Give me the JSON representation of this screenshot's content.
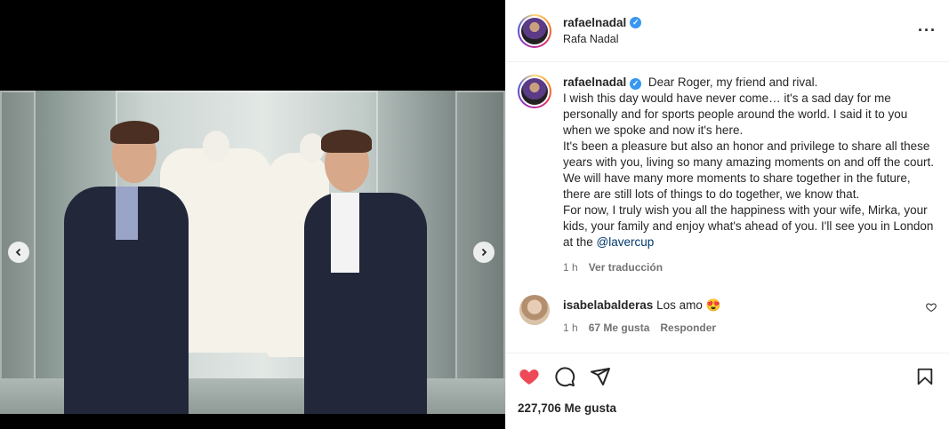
{
  "post": {
    "username": "rafaelnadal",
    "fullname": "Rafa Nadal",
    "verified_icon": "verified-badge-icon",
    "more_icon": "more-options-icon"
  },
  "caption": {
    "username": "rafaelnadal",
    "line1": "Dear Roger, my friend and rival.",
    "line2": "I wish this day would have never come… it's a sad day for me personally and for sports people around the world. I said it to you when we spoke and now it's here.",
    "line3": "It's been a pleasure but also an honor and privilege to share all these years with you, living so many amazing moments on and off the court.",
    "line4": "We will have many more moments to share together in the future, there are still lots of things to do together, we know that.",
    "line5_start": "For now, I truly wish you all the happiness with your wife, Mirka, your kids, your family and enjoy what's ahead of you. I'll see you in London at the ",
    "mention": "@lavercup",
    "time": "1 h",
    "see_translation": "Ver traducción"
  },
  "comment": {
    "username": "isabelabalderas",
    "text": "Los amo 😍",
    "time": "1 h",
    "likes": "67 Me gusta",
    "reply": "Responder"
  },
  "actions": {
    "likes_count": "227,706 Me gusta"
  }
}
